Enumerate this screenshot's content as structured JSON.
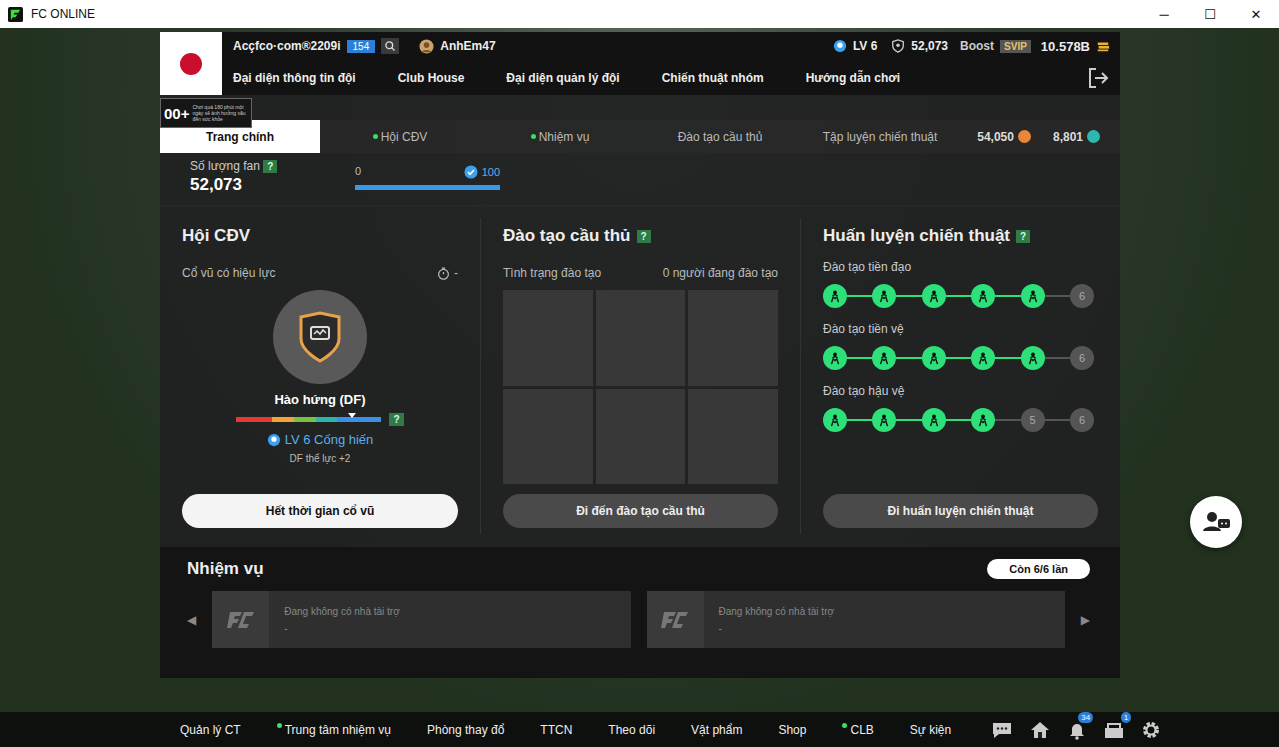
{
  "window": {
    "title": "FC ONLINE",
    "controls": [
      "─",
      "☐",
      "✕"
    ]
  },
  "header": {
    "team": "Acçfco·com®2209i",
    "team_level": "154",
    "manager": "AnhEm47",
    "level": "LV 6",
    "fans": "52,073",
    "boost": "Boost",
    "boost_tier": "SVIP",
    "coins": "10.578B",
    "menu": [
      "Đại diện thông tin đội",
      "Club House",
      "Đại diện quản lý đội",
      "Chiến thuật nhóm",
      "Hướng dẫn chơi"
    ]
  },
  "age_rating": {
    "label": "00+",
    "notice": "Chơi quá 180 phút một ngày sẽ ảnh hưởng xấu đến sức khỏe"
  },
  "tabs": [
    {
      "label": "Trang chính",
      "selected": true,
      "dot": false
    },
    {
      "label": "Hội CĐV",
      "selected": false,
      "dot": true
    },
    {
      "label": "Nhiệm vụ",
      "selected": false,
      "dot": true
    },
    {
      "label": "Đào tạo cầu thủ",
      "selected": false,
      "dot": false
    },
    {
      "label": "Tập luyện chiến thuật",
      "selected": false,
      "dot": false
    }
  ],
  "currencies": [
    {
      "amount": "54,050",
      "color": "#e8873a"
    },
    {
      "amount": "8,801",
      "color": "#2bb8b0"
    }
  ],
  "fan_count": {
    "label": "Số lượng fan",
    "help": "?",
    "value": "52,073",
    "min": "0",
    "max": "100",
    "level": 1.0,
    "reached": true
  },
  "supporters": {
    "title": "Hội CĐV",
    "active_label": "Cổ vũ có hiệu lực",
    "timer": "-",
    "mood": "Hào hứng (DF)",
    "mood_level": 0.8,
    "help": "?",
    "rank": "LV 6 Cống hiến",
    "effect": "DF thể lực +2",
    "button": "Hết thời gian cổ vũ"
  },
  "training": {
    "title": "Đào tạo cầu thủ",
    "help": "?",
    "status_label": "Tình trạng đào tạo",
    "status": "0 người đang đào tạo",
    "slots": 6,
    "button": "Đi đến đào tạo cầu thủ"
  },
  "tactics": {
    "title": "Huấn luyện chiến thuật",
    "help": "?",
    "button": "Đi huấn luyện chiến thuật",
    "tracks": [
      {
        "label": "Đào tạo tiền đạo",
        "nodes": [
          {
            "kind": "icon",
            "done": true,
            "label": ""
          },
          {
            "kind": "icon",
            "done": true,
            "label": ""
          },
          {
            "kind": "icon",
            "done": true,
            "label": ""
          },
          {
            "kind": "icon",
            "done": true,
            "label": ""
          },
          {
            "kind": "icon",
            "done": true,
            "label": ""
          },
          {
            "kind": "number",
            "done": false,
            "label": "6"
          }
        ]
      },
      {
        "label": "Đào tạo tiền vệ",
        "nodes": [
          {
            "kind": "icon",
            "done": true,
            "label": ""
          },
          {
            "kind": "icon",
            "done": true,
            "label": ""
          },
          {
            "kind": "icon",
            "done": true,
            "label": ""
          },
          {
            "kind": "icon",
            "done": true,
            "label": ""
          },
          {
            "kind": "icon",
            "done": true,
            "label": ""
          },
          {
            "kind": "number",
            "done": false,
            "label": "6"
          }
        ]
      },
      {
        "label": "Đào tạo hậu vệ",
        "nodes": [
          {
            "kind": "icon",
            "done": true,
            "label": ""
          },
          {
            "kind": "icon",
            "done": true,
            "label": ""
          },
          {
            "kind": "icon",
            "done": true,
            "label": ""
          },
          {
            "kind": "icon",
            "done": true,
            "label": ""
          },
          {
            "kind": "number",
            "done": false,
            "label": "5"
          },
          {
            "kind": "number",
            "done": false,
            "label": "6"
          }
        ]
      }
    ]
  },
  "missions": {
    "title": "Nhiệm vụ",
    "remaining": "Còn 6/6 lần",
    "prev": "◀",
    "next": "▶",
    "cards": [
      {
        "title": "Đang không có nhà tài trợ",
        "detail": "-"
      },
      {
        "title": "Đang không có nhà tài trợ",
        "detail": "-"
      }
    ]
  },
  "bottom_nav": {
    "items": [
      {
        "label": "Quản lý CT",
        "dot": false
      },
      {
        "label": "Trung tâm nhiệm vụ",
        "dot": true
      },
      {
        "label": "Phòng thay đổ",
        "dot": false
      },
      {
        "label": "TTCN",
        "dot": false
      },
      {
        "label": "Theo dõi",
        "dot": false
      },
      {
        "label": "Vật phẩm",
        "dot": false
      },
      {
        "label": "Shop",
        "dot": false
      },
      {
        "label": "CLB",
        "dot": true
      },
      {
        "label": "Sự kiện",
        "dot": false
      }
    ],
    "notifications": "34",
    "mail": "1"
  }
}
